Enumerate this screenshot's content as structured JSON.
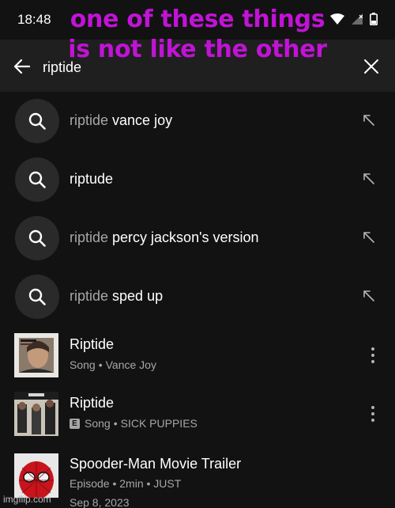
{
  "status": {
    "time": "18:48"
  },
  "caption": {
    "line1": "one of these things",
    "line2": "is not like the other"
  },
  "search": {
    "query": "riptide"
  },
  "suggestions": [
    {
      "prefix": "riptide",
      "suffix": " vance joy"
    },
    {
      "prefix": "",
      "suffix": "riptude"
    },
    {
      "prefix": "riptide",
      "suffix": " percy jackson's version"
    },
    {
      "prefix": "riptide",
      "suffix": " sped up"
    }
  ],
  "results": [
    {
      "title": "Riptide",
      "type": "Song",
      "separator": "•",
      "artist": "Vance Joy",
      "explicit": false
    },
    {
      "title": "Riptide",
      "type": "Song",
      "separator": "•",
      "artist": "SICK PUPPIES",
      "explicit": true,
      "explicit_label": "E"
    },
    {
      "title": "Spooder-Man Movie Trailer",
      "subtitle": "Episode • 2min • JUST",
      "date": "Sep 8, 2023"
    }
  ],
  "watermark": "imgflip.com",
  "colors": {
    "background": "#121212",
    "header": "#1f1f1f",
    "caption": "#c113d6",
    "secondary_text": "#a7a7a7"
  }
}
